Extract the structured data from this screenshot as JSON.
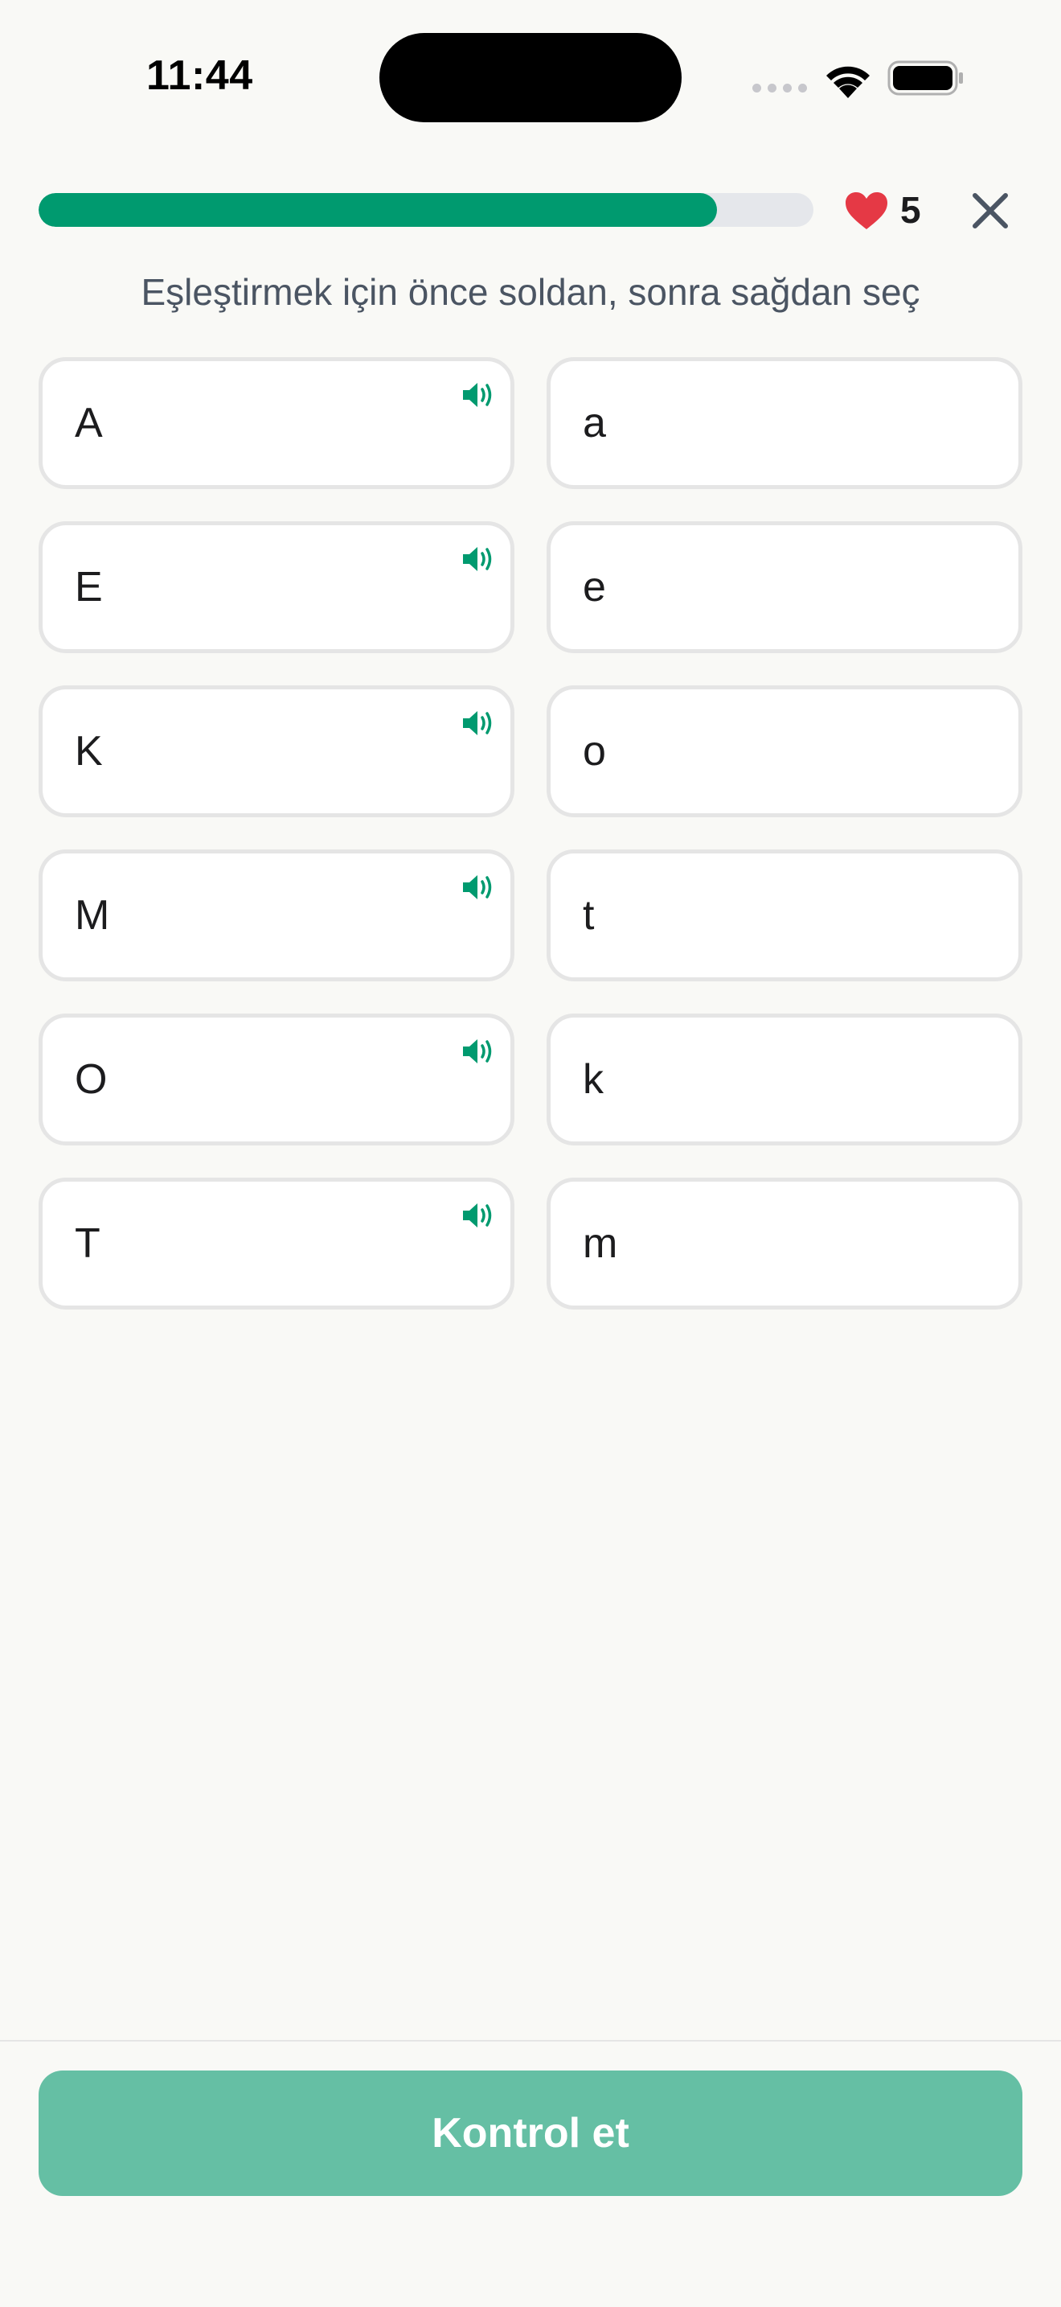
{
  "status_bar": {
    "time": "11:44"
  },
  "header": {
    "progress": 0.875,
    "lives": "5",
    "close_icon": "close-icon",
    "heart_icon": "heart-icon"
  },
  "instruction": "Eşleştirmek için önce soldan, sonra sağdan seç",
  "left_items": [
    "A",
    "E",
    "K",
    "M",
    "O",
    "T"
  ],
  "right_items": [
    "a",
    "e",
    "o",
    "t",
    "k",
    "m"
  ],
  "check_button_label": "Kontrol et",
  "colors": {
    "accent": "#009a6f",
    "button_disabled": "#65bfa4",
    "heart": "#e53945"
  }
}
